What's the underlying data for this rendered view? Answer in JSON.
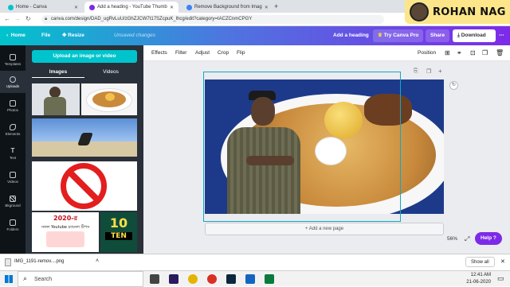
{
  "browser": {
    "tabs": [
      {
        "label": "Home - Canva",
        "color": "#00c4cc"
      },
      {
        "label": "Add a heading - YouTube Thumb",
        "color": "#7d2ae8"
      },
      {
        "label": "Remove Background from Imag",
        "color": "#3b82f6"
      }
    ],
    "url": "canva.com/design/DAD_ugRvLuU/zGhZJCW7t17SZcpuK_lhcg/edit?category=tACZCnmCPGY"
  },
  "badge": {
    "name": "ROHAN NAG"
  },
  "header": {
    "home": "Home",
    "file": "File",
    "resize": "Resize",
    "status": "Unsaved changes",
    "title": "Add a heading",
    "try_pro": "Try Canva Pro",
    "share": "Share",
    "download": "Download"
  },
  "rail": {
    "items": [
      "Templates",
      "Uploads",
      "Photos",
      "Elements",
      "Text",
      "Videos",
      "Bkground",
      "Folders"
    ]
  },
  "panel": {
    "upload_label": "Upload an image or video",
    "tabs": [
      "Images",
      "Videos"
    ],
    "thumb_texts": {
      "year": "2020-র",
      "line1": "সফল Youtube চ্যানেল টিপস",
      "ten_num": "10",
      "ten_word": "TEN"
    }
  },
  "toolbar": {
    "items": [
      "Effects",
      "Filter",
      "Adjust",
      "Crop",
      "Flip"
    ],
    "position": "Position"
  },
  "canvas": {
    "add_page": "+ Add a new page",
    "zoom": "56%",
    "help": "Help ?"
  },
  "downloads": {
    "file": "IMG_1191-remov....png",
    "show_all": "Show all"
  },
  "taskbar": {
    "search": "Search",
    "time": "12:41 AM",
    "date": "21-06-2020"
  },
  "colors": {
    "teal": "#00c4cc",
    "purple": "#7d2ae8",
    "panel": "#293039",
    "rail": "#0e1318",
    "selection": "#12a8c4"
  }
}
